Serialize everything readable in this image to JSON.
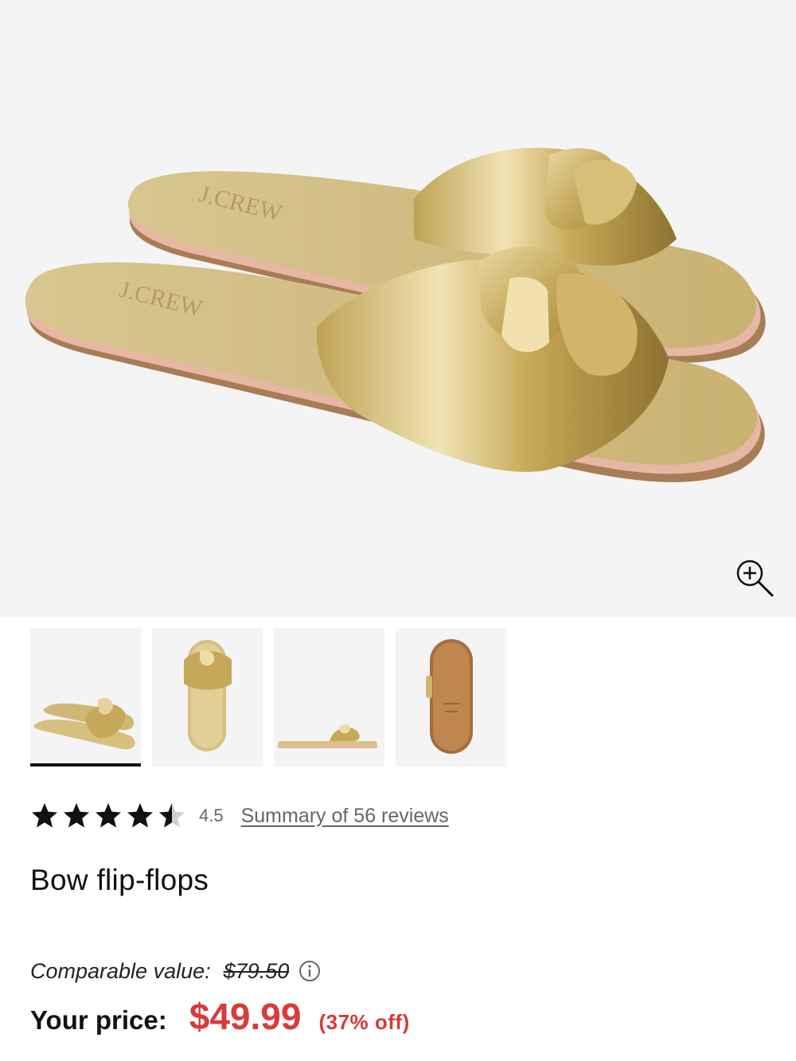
{
  "product": {
    "main_image_alt": "Gold metallic bow slide sandals",
    "brand_mark": "J.CREW",
    "thumbnails": [
      {
        "view": "pair-angle",
        "selected": true
      },
      {
        "view": "top"
      },
      {
        "view": "side"
      },
      {
        "view": "sole"
      }
    ],
    "rating": {
      "value": 4.5,
      "value_label": "4.5",
      "stars_max": 5,
      "reviews_link": "Summary of 56 reviews"
    },
    "title": "Bow flip-flops",
    "comparable_label": "Comparable value:",
    "comparable_price": "$79.50",
    "your_price_label": "Your price:",
    "your_price": "$49.99",
    "discount": "(37% off)"
  },
  "icons": {
    "zoom": "zoom-in-icon",
    "info": "info-icon",
    "star": "star-icon"
  },
  "colors": {
    "sale_red": "#d93a3a",
    "text": "#111111",
    "muted": "#666666",
    "image_bg": "#f4f4f4",
    "gold": "#d6bf7a"
  }
}
